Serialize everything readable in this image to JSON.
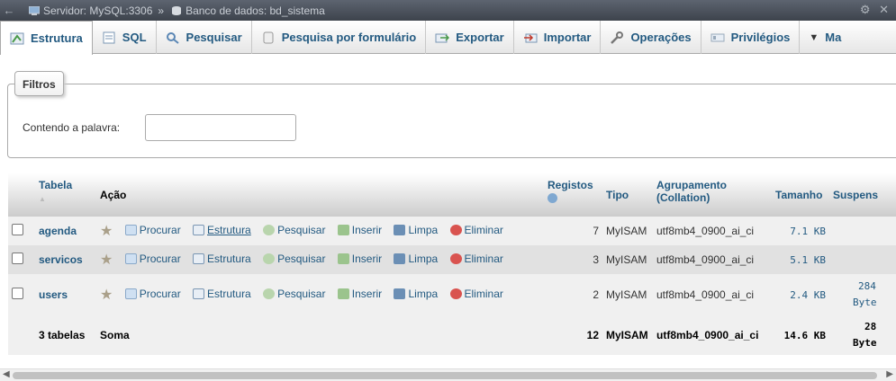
{
  "topbar": {
    "back_icon": "arrow-left-icon",
    "server": "Servidor: MySQL:3306",
    "separator": "»",
    "database": "Banco de dados: bd_sistema",
    "settings_icon": "gear-icon",
    "close_glyph": "✕"
  },
  "tabs": [
    {
      "label": "Estrutura",
      "icon": "structure-icon",
      "active": true
    },
    {
      "label": "SQL",
      "icon": "sql-icon"
    },
    {
      "label": "Pesquisar",
      "icon": "search-icon"
    },
    {
      "label": "Pesquisa por formulário",
      "icon": "query-icon"
    },
    {
      "label": "Exportar",
      "icon": "export-icon"
    },
    {
      "label": "Importar",
      "icon": "import-icon"
    },
    {
      "label": "Operações",
      "icon": "wrench-icon"
    },
    {
      "label": "Privilégios",
      "icon": "privileges-icon"
    },
    {
      "label": "Ma",
      "icon": "caret-down-icon"
    }
  ],
  "filters": {
    "legend": "Filtros",
    "label": "Contendo a palavra:",
    "value": ""
  },
  "table": {
    "headers": {
      "tabela": "Tabela",
      "sort_glyph": "▲",
      "acao": "Ação",
      "registos": "Registos",
      "tipo": "Tipo",
      "agrupamento": "Agrupamento",
      "collation": "(Collation)",
      "tamanho": "Tamanho",
      "suspenso": "Suspens"
    },
    "actions": {
      "procurar": "Procurar",
      "estrutura": "Estrutura",
      "pesquisar": "Pesquisar",
      "inserir": "Inserir",
      "limpa": "Limpa",
      "eliminar": "Eliminar"
    },
    "rows": [
      {
        "name": "agenda",
        "registos": "7",
        "tipo": "MyISAM",
        "collation": "utf8mb4_0900_ai_ci",
        "tamanho": "7.1 KB",
        "suspenso1": "",
        "suspenso2": ""
      },
      {
        "name": "servicos",
        "registos": "3",
        "tipo": "MyISAM",
        "collation": "utf8mb4_0900_ai_ci",
        "tamanho": "5.1 KB",
        "suspenso1": "",
        "suspenso2": ""
      },
      {
        "name": "users",
        "registos": "2",
        "tipo": "MyISAM",
        "collation": "utf8mb4_0900_ai_ci",
        "tamanho": "2.4 KB",
        "suspenso1": "284",
        "suspenso2": "Byte"
      }
    ],
    "footer": {
      "tabelas": "3 tabelas",
      "soma": "Soma",
      "registos": "12",
      "tipo": "MyISAM",
      "collation": "utf8mb4_0900_ai_ci",
      "tamanho": "14.6 KB",
      "suspenso1": "28",
      "suspenso2": "Byte"
    }
  },
  "colors": {
    "link": "#235a81",
    "eliminar": "#d9534f"
  }
}
